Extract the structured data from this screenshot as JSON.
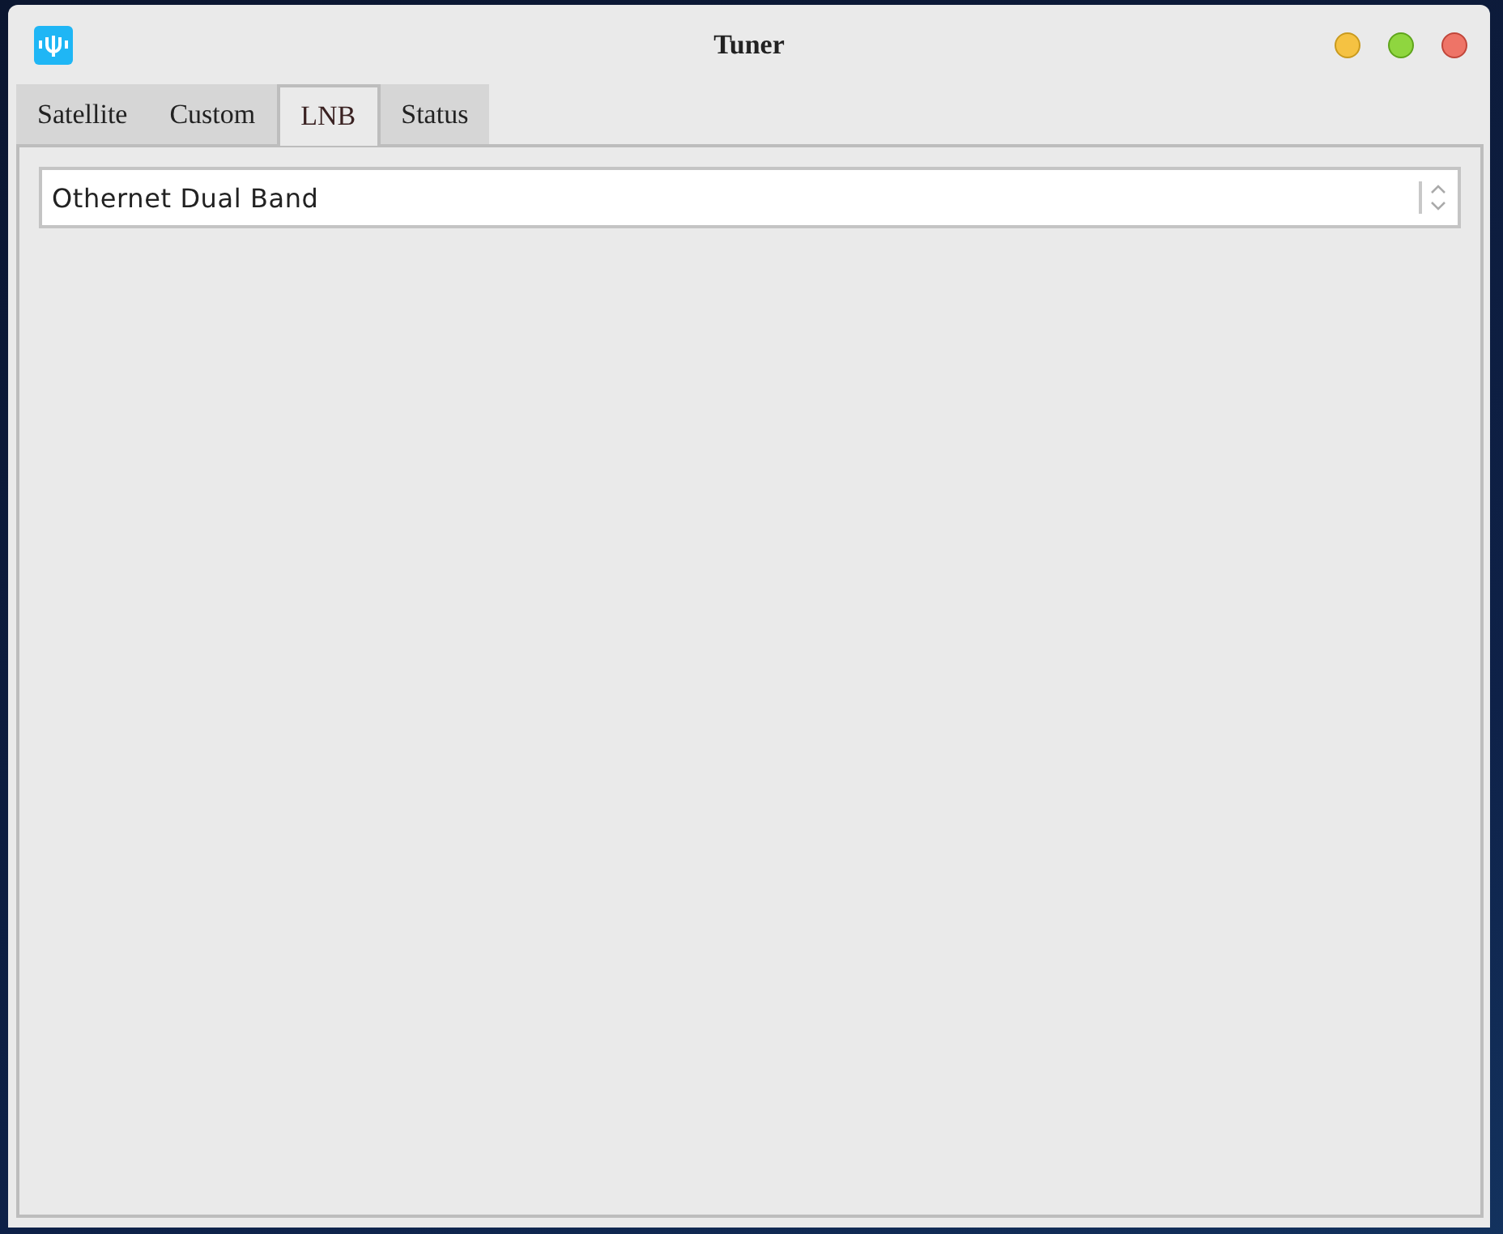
{
  "window": {
    "title": "Tuner",
    "controls": [
      {
        "kind": "minimize"
      },
      {
        "kind": "maximize"
      },
      {
        "kind": "close"
      }
    ]
  },
  "tabs": [
    {
      "label": "Satellite",
      "selected": false
    },
    {
      "label": "Custom",
      "selected": false
    },
    {
      "label": "LNB",
      "selected": true
    },
    {
      "label": "Status",
      "selected": false
    }
  ],
  "lnb_select": {
    "value": "Othernet Dual Band"
  }
}
